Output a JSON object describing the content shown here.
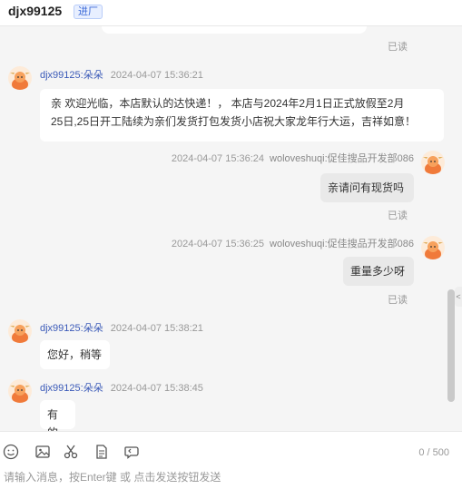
{
  "header": {
    "title": "djx99125",
    "tag": "进厂"
  },
  "read_label": "已读",
  "messages": [
    {
      "nick": "djx99125:朵朵",
      "time": "2024-04-07 15:36:21",
      "line1": "亲 欢迎光临，本店默认的达快递！，  本店与2024年2月1日正式放假至2月",
      "line2": "25日,25日开工陆续为亲们发货打包发货小店祝大家龙年行大运，吉祥如意！"
    },
    {
      "nick": "woloveshuqi:促佳搜品开发部086",
      "time": "2024-04-07 15:36:24",
      "text": "亲请问有现货吗"
    },
    {
      "nick": "woloveshuqi:促佳搜品开发部086",
      "time": "2024-04-07 15:36:25",
      "text": "重量多少呀"
    },
    {
      "nick": "djx99125:朵朵",
      "time": "2024-04-07 15:38:21",
      "text": "您好，稍等"
    },
    {
      "nick": "djx99125:朵朵",
      "time": "2024-04-07 15:38:45",
      "text": "有的"
    }
  ],
  "toolbar": {
    "icons": [
      "emoji-icon",
      "image-icon",
      "scissors-icon",
      "document-icon",
      "history-icon"
    ],
    "counter": "0 / 500"
  },
  "input": {
    "placeholder": "请输入消息，按Enter键 或 点击发送按钮发送",
    "value": ""
  },
  "side_tab": "<",
  "colors": {
    "nick": "#3b5ab8",
    "read": "#999999",
    "chat_bg": "#f5f5f5",
    "mine_bubble": "#e9e9e9"
  }
}
